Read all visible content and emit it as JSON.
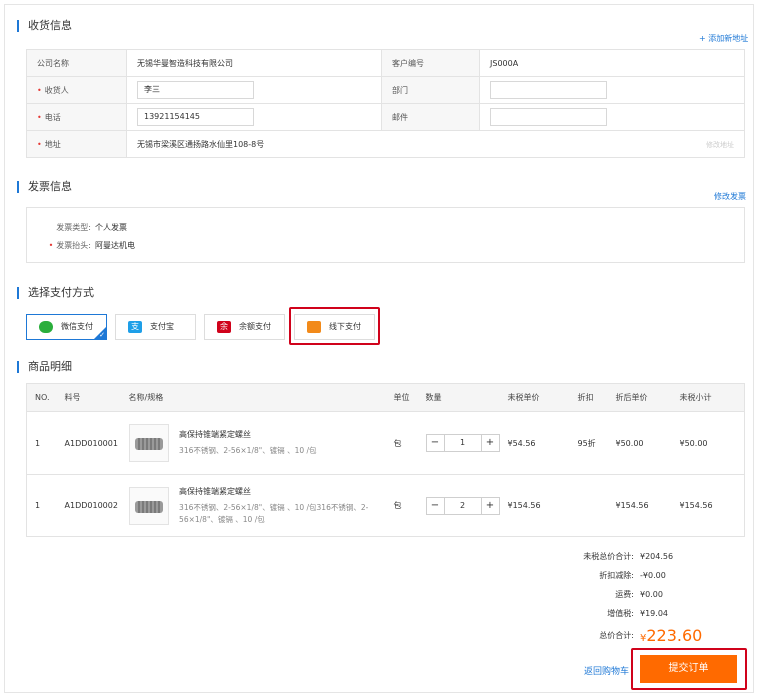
{
  "shipping": {
    "title": "收货信息",
    "add_address": "+ 添加新地址",
    "company_label": "公司名称",
    "company_value": "无锡华曼智造科技有限公司",
    "customer_no_label": "客户编号",
    "customer_no_value": "JS000A",
    "receiver_label": "收货人",
    "receiver_value": "李三",
    "dept_label": "部门",
    "dept_value": "",
    "phone_label": "电话",
    "phone_value": "13921154145",
    "email_label": "邮件",
    "email_value": "",
    "address_label": "地址",
    "address_value": "无锡市梁溪区通扬路水仙里108-8号",
    "address_hint": "修改地址"
  },
  "invoice": {
    "title": "发票信息",
    "edit": "修改发票",
    "type_label": "发票类型:",
    "type_value": "个人发票",
    "header_label": "发票抬头:",
    "header_value": "阿曼达机电"
  },
  "payment": {
    "title": "选择支付方式",
    "methods": [
      {
        "label": "微信支付",
        "icon": "wechat-icon",
        "color": "#2aae3c"
      },
      {
        "label": "支付宝",
        "icon": "alipay-icon",
        "color": "#1e9fe8"
      },
      {
        "label": "余额支付",
        "icon": "balance-icon",
        "color": "#d0021b"
      },
      {
        "label": "线下支付",
        "icon": "offline-icon",
        "color": "#f28a1a"
      }
    ]
  },
  "products": {
    "title": "商品明细",
    "headers": [
      "NO.",
      "料号",
      "名称/规格",
      "单位",
      "数量",
      "未税单价",
      "折扣",
      "折后单价",
      "未税小计"
    ],
    "rows": [
      {
        "no": "1",
        "sku": "A1DD010001",
        "name": "高保持锥端紧定螺丝",
        "spec": "316不锈钢、2-56×1/8\"、镀镉 、10 /包",
        "unit": "包",
        "qty": "1",
        "price": "¥54.56",
        "discount": "95折",
        "disc_price": "¥50.00",
        "subtotal": "¥50.00"
      },
      {
        "no": "1",
        "sku": "A1DD010002",
        "name": "高保持锥端紧定螺丝",
        "spec": "316不锈钢、2-56×1/8\"、镀镉 、10 /包316不锈钢、2-56×1/8\"、镀镉 、10 /包",
        "unit": "包",
        "qty": "2",
        "price": "¥154.56",
        "discount": "",
        "disc_price": "¥154.56",
        "subtotal": "¥154.56"
      }
    ]
  },
  "summary": {
    "pretax_label": "未税总价合计:",
    "pretax_value": "¥204.56",
    "discount_label": "折扣减除:",
    "discount_value": "-¥0.00",
    "freight_label": "运费:",
    "freight_value": "¥0.00",
    "vat_label": "增值税:",
    "vat_value": "¥19.04",
    "total_label": "总价合计:",
    "total_currency": "¥",
    "total_value": "223.60",
    "back_link": "返回购物车",
    "submit": "提交订单"
  },
  "colors": {
    "accent": "#1e78d6",
    "orange": "#ff6a00",
    "highlight": "#d0021b"
  }
}
